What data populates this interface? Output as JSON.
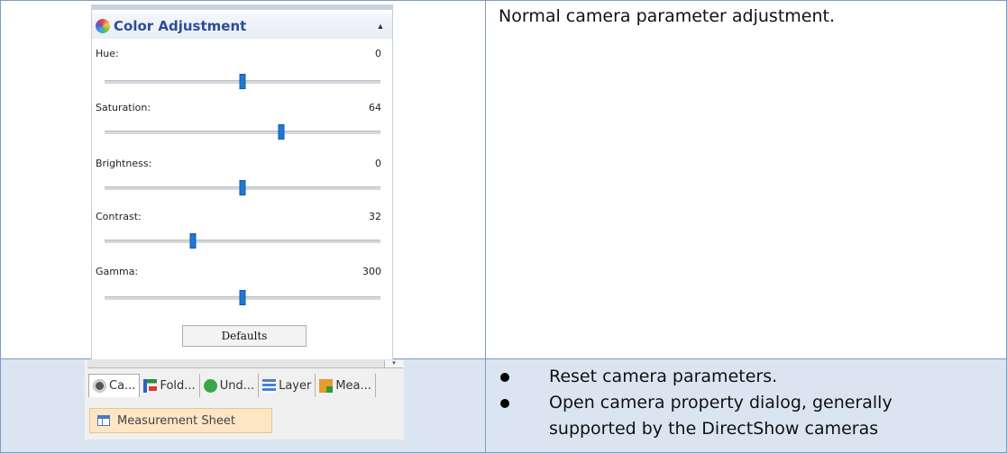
{
  "panel": {
    "title": "Color Adjustment",
    "icon": "color-wheel-icon",
    "collapse_glyph": "▲",
    "parameters": [
      {
        "label": "Hue:",
        "value": "0",
        "slider_position": 0.5
      },
      {
        "label": "Saturation:",
        "value": "64",
        "slider_position": 0.64
      },
      {
        "label": "Brightness:",
        "value": "0",
        "slider_position": 0.5
      },
      {
        "label": "Contrast:",
        "value": "32",
        "slider_position": 0.32
      },
      {
        "label": "Gamma:",
        "value": "300",
        "slider_position": 0.5
      }
    ],
    "defaults_label": "Defaults"
  },
  "descriptions": {
    "row1": "Normal camera parameter adjustment.",
    "row2_bullets": [
      "Reset camera parameters.",
      "Open camera property dialog, generally",
      "supported by the DirectShow cameras"
    ]
  },
  "tabs": [
    {
      "label": "Ca...",
      "icon": "camera-icon",
      "active": true
    },
    {
      "label": "Fold...",
      "icon": "folder-tree-icon",
      "active": false
    },
    {
      "label": "Und...",
      "icon": "undo-icon",
      "active": false
    },
    {
      "label": "Layer",
      "icon": "layer-icon",
      "active": false
    },
    {
      "label": "Mea...",
      "icon": "measurement-icon",
      "active": false
    }
  ],
  "sheet_tab": {
    "label": "Measurement Sheet",
    "icon": "sheet-icon"
  },
  "colors": {
    "title_blue": "#2a4e96",
    "slider_thumb": "#1f78d1",
    "row2_background": "#dbe5f1",
    "sheet_tab_background": "#fde6c4",
    "table_border": "#7f9bbd"
  }
}
